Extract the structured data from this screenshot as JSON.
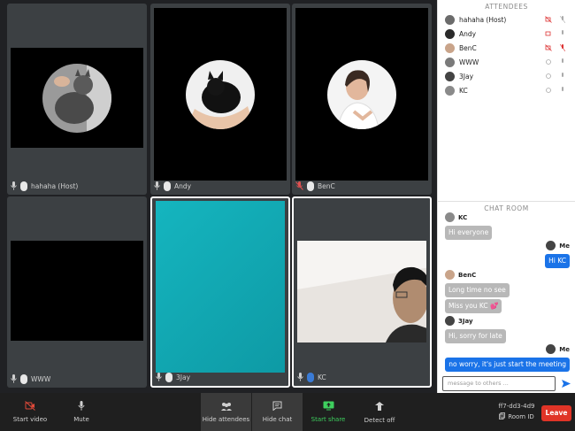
{
  "tiles": [
    {
      "name": "hahaha (Host)",
      "muted": false,
      "video": true
    },
    {
      "name": "Andy",
      "muted": false,
      "video": true
    },
    {
      "name": "BenC",
      "muted": true,
      "video": true
    },
    {
      "name": "WWW",
      "muted": false,
      "video": true
    },
    {
      "name": "3Jay",
      "muted": false,
      "video": true
    },
    {
      "name": "KC",
      "muted": false,
      "video": true
    }
  ],
  "attendees": {
    "title": "ATTENDEES",
    "items": [
      {
        "name": "hahaha  (Host)",
        "cam_off": true,
        "mic_off": true
      },
      {
        "name": "Andy",
        "cam_off": false,
        "mic_off": false
      },
      {
        "name": "BenC",
        "cam_off": true,
        "mic_off": true
      },
      {
        "name": "WWW",
        "cam_off": false,
        "mic_off": false
      },
      {
        "name": "3Jay",
        "cam_off": false,
        "mic_off": false
      },
      {
        "name": "KC",
        "cam_off": false,
        "mic_off": false
      }
    ]
  },
  "chat": {
    "title": "CHAT ROOM",
    "messages": [
      {
        "sender": "KC",
        "text": "Hi everyone",
        "me": false
      },
      {
        "sender": "Me",
        "text": "Hi KC",
        "me": true
      },
      {
        "sender": "BenC",
        "text": "Long time no see",
        "me": false
      },
      {
        "sender": "",
        "text": "Miss you KC 💕",
        "me": false
      },
      {
        "sender": "3Jay",
        "text": "Hi, sorry for late",
        "me": false
      },
      {
        "sender": "Me",
        "text": "no worry, it's just start the meeting",
        "me": true
      }
    ],
    "input_placeholder": "message to others ..."
  },
  "toolbar": {
    "start_video": "Start video",
    "mute": "Mute",
    "hide_attendees": "Hide attendees",
    "hide_chat": "Hide chat",
    "start_share": "Start share",
    "detect_off": "Detect off",
    "room_code": "ff7-dd3-4d9",
    "room_id_label": "Room ID",
    "leave": "Leave"
  },
  "colors": {
    "accent_blue": "#1a73e8",
    "leave_red": "#e03427",
    "share_green": "#3ecf5e"
  }
}
